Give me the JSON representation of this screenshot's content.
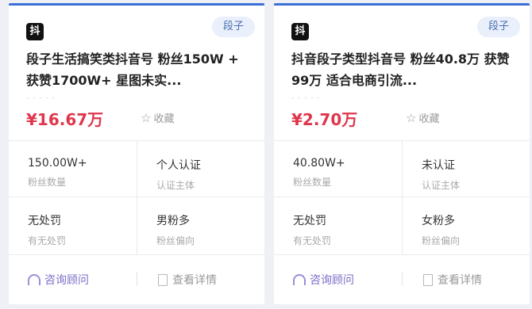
{
  "cards": [
    {
      "platform_icon": "抖",
      "tag": "段子",
      "title": "段子生活搞笑类抖音号 粉丝150W + 获赞1700W+ 星图未实...",
      "dashes": "- - - - -",
      "price": "¥16.67万",
      "favorite_label": "收藏",
      "stats": [
        {
          "value": "150.00W+",
          "label": "粉丝数量"
        },
        {
          "value": "个人认证",
          "label": "认证主体"
        },
        {
          "value": "无处罚",
          "label": "有无处罚"
        },
        {
          "value": "男粉多",
          "label": "粉丝偏向"
        }
      ],
      "consult_label": "咨询顾问",
      "detail_label": "查看详情"
    },
    {
      "platform_icon": "抖",
      "tag": "段子",
      "title": "抖音段子类型抖音号 粉丝40.8万 获赞99万 适合电商引流...",
      "dashes": "- - - - -",
      "price": "¥2.70万",
      "favorite_label": "收藏",
      "stats": [
        {
          "value": "40.80W+",
          "label": "粉丝数量"
        },
        {
          "value": "未认证",
          "label": "认证主体"
        },
        {
          "value": "无处罚",
          "label": "有无处罚"
        },
        {
          "value": "女粉多",
          "label": "粉丝偏向"
        }
      ],
      "consult_label": "咨询顾问",
      "detail_label": "查看详情"
    }
  ],
  "colors": {
    "accent_top": "#3b6fd8",
    "price": "#e0364c",
    "consult": "#7a6fc8",
    "tag_bg": "#e9f0fb"
  }
}
